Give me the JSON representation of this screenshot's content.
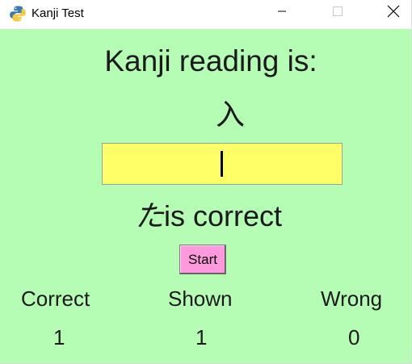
{
  "window": {
    "title": "Kanji Test",
    "icon": "python-icon",
    "controls": [
      "minimize-icon",
      "maximize-icon",
      "close-icon"
    ]
  },
  "main": {
    "heading": "Kanji reading is:",
    "kanji": "入",
    "answer_value": "",
    "feedback_kana": "た",
    "feedback_text": "is correct",
    "start_label": "Start"
  },
  "stats": {
    "correct_label": "Correct",
    "shown_label": "Shown",
    "wrong_label": "Wrong",
    "correct_value": "1",
    "shown_value": "1",
    "wrong_value": "0"
  },
  "colors": {
    "background": "#b5fdb5",
    "answer_field": "#ffff66",
    "start_button": "#ff99dd"
  }
}
